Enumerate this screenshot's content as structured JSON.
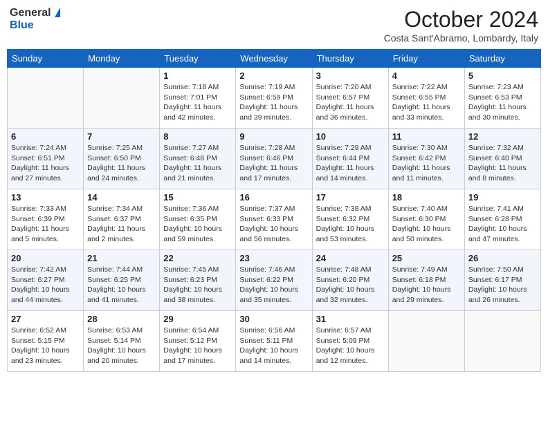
{
  "header": {
    "logo_general": "General",
    "logo_blue": "Blue",
    "month_title": "October 2024",
    "location": "Costa Sant'Abramo, Lombardy, Italy"
  },
  "days_of_week": [
    "Sunday",
    "Monday",
    "Tuesday",
    "Wednesday",
    "Thursday",
    "Friday",
    "Saturday"
  ],
  "weeks": [
    [
      {
        "day": "",
        "info": ""
      },
      {
        "day": "",
        "info": ""
      },
      {
        "day": "1",
        "sunrise": "Sunrise: 7:18 AM",
        "sunset": "Sunset: 7:01 PM",
        "daylight": "Daylight: 11 hours and 42 minutes."
      },
      {
        "day": "2",
        "sunrise": "Sunrise: 7:19 AM",
        "sunset": "Sunset: 6:59 PM",
        "daylight": "Daylight: 11 hours and 39 minutes."
      },
      {
        "day": "3",
        "sunrise": "Sunrise: 7:20 AM",
        "sunset": "Sunset: 6:57 PM",
        "daylight": "Daylight: 11 hours and 36 minutes."
      },
      {
        "day": "4",
        "sunrise": "Sunrise: 7:22 AM",
        "sunset": "Sunset: 6:55 PM",
        "daylight": "Daylight: 11 hours and 33 minutes."
      },
      {
        "day": "5",
        "sunrise": "Sunrise: 7:23 AM",
        "sunset": "Sunset: 6:53 PM",
        "daylight": "Daylight: 11 hours and 30 minutes."
      }
    ],
    [
      {
        "day": "6",
        "sunrise": "Sunrise: 7:24 AM",
        "sunset": "Sunset: 6:51 PM",
        "daylight": "Daylight: 11 hours and 27 minutes."
      },
      {
        "day": "7",
        "sunrise": "Sunrise: 7:25 AM",
        "sunset": "Sunset: 6:50 PM",
        "daylight": "Daylight: 11 hours and 24 minutes."
      },
      {
        "day": "8",
        "sunrise": "Sunrise: 7:27 AM",
        "sunset": "Sunset: 6:48 PM",
        "daylight": "Daylight: 11 hours and 21 minutes."
      },
      {
        "day": "9",
        "sunrise": "Sunrise: 7:28 AM",
        "sunset": "Sunset: 6:46 PM",
        "daylight": "Daylight: 11 hours and 17 minutes."
      },
      {
        "day": "10",
        "sunrise": "Sunrise: 7:29 AM",
        "sunset": "Sunset: 6:44 PM",
        "daylight": "Daylight: 11 hours and 14 minutes."
      },
      {
        "day": "11",
        "sunrise": "Sunrise: 7:30 AM",
        "sunset": "Sunset: 6:42 PM",
        "daylight": "Daylight: 11 hours and 11 minutes."
      },
      {
        "day": "12",
        "sunrise": "Sunrise: 7:32 AM",
        "sunset": "Sunset: 6:40 PM",
        "daylight": "Daylight: 11 hours and 8 minutes."
      }
    ],
    [
      {
        "day": "13",
        "sunrise": "Sunrise: 7:33 AM",
        "sunset": "Sunset: 6:39 PM",
        "daylight": "Daylight: 11 hours and 5 minutes."
      },
      {
        "day": "14",
        "sunrise": "Sunrise: 7:34 AM",
        "sunset": "Sunset: 6:37 PM",
        "daylight": "Daylight: 11 hours and 2 minutes."
      },
      {
        "day": "15",
        "sunrise": "Sunrise: 7:36 AM",
        "sunset": "Sunset: 6:35 PM",
        "daylight": "Daylight: 10 hours and 59 minutes."
      },
      {
        "day": "16",
        "sunrise": "Sunrise: 7:37 AM",
        "sunset": "Sunset: 6:33 PM",
        "daylight": "Daylight: 10 hours and 56 minutes."
      },
      {
        "day": "17",
        "sunrise": "Sunrise: 7:38 AM",
        "sunset": "Sunset: 6:32 PM",
        "daylight": "Daylight: 10 hours and 53 minutes."
      },
      {
        "day": "18",
        "sunrise": "Sunrise: 7:40 AM",
        "sunset": "Sunset: 6:30 PM",
        "daylight": "Daylight: 10 hours and 50 minutes."
      },
      {
        "day": "19",
        "sunrise": "Sunrise: 7:41 AM",
        "sunset": "Sunset: 6:28 PM",
        "daylight": "Daylight: 10 hours and 47 minutes."
      }
    ],
    [
      {
        "day": "20",
        "sunrise": "Sunrise: 7:42 AM",
        "sunset": "Sunset: 6:27 PM",
        "daylight": "Daylight: 10 hours and 44 minutes."
      },
      {
        "day": "21",
        "sunrise": "Sunrise: 7:44 AM",
        "sunset": "Sunset: 6:25 PM",
        "daylight": "Daylight: 10 hours and 41 minutes."
      },
      {
        "day": "22",
        "sunrise": "Sunrise: 7:45 AM",
        "sunset": "Sunset: 6:23 PM",
        "daylight": "Daylight: 10 hours and 38 minutes."
      },
      {
        "day": "23",
        "sunrise": "Sunrise: 7:46 AM",
        "sunset": "Sunset: 6:22 PM",
        "daylight": "Daylight: 10 hours and 35 minutes."
      },
      {
        "day": "24",
        "sunrise": "Sunrise: 7:48 AM",
        "sunset": "Sunset: 6:20 PM",
        "daylight": "Daylight: 10 hours and 32 minutes."
      },
      {
        "day": "25",
        "sunrise": "Sunrise: 7:49 AM",
        "sunset": "Sunset: 6:18 PM",
        "daylight": "Daylight: 10 hours and 29 minutes."
      },
      {
        "day": "26",
        "sunrise": "Sunrise: 7:50 AM",
        "sunset": "Sunset: 6:17 PM",
        "daylight": "Daylight: 10 hours and 26 minutes."
      }
    ],
    [
      {
        "day": "27",
        "sunrise": "Sunrise: 6:52 AM",
        "sunset": "Sunset: 5:15 PM",
        "daylight": "Daylight: 10 hours and 23 minutes."
      },
      {
        "day": "28",
        "sunrise": "Sunrise: 6:53 AM",
        "sunset": "Sunset: 5:14 PM",
        "daylight": "Daylight: 10 hours and 20 minutes."
      },
      {
        "day": "29",
        "sunrise": "Sunrise: 6:54 AM",
        "sunset": "Sunset: 5:12 PM",
        "daylight": "Daylight: 10 hours and 17 minutes."
      },
      {
        "day": "30",
        "sunrise": "Sunrise: 6:56 AM",
        "sunset": "Sunset: 5:11 PM",
        "daylight": "Daylight: 10 hours and 14 minutes."
      },
      {
        "day": "31",
        "sunrise": "Sunrise: 6:57 AM",
        "sunset": "Sunset: 5:09 PM",
        "daylight": "Daylight: 10 hours and 12 minutes."
      },
      {
        "day": "",
        "info": ""
      },
      {
        "day": "",
        "info": ""
      }
    ]
  ]
}
